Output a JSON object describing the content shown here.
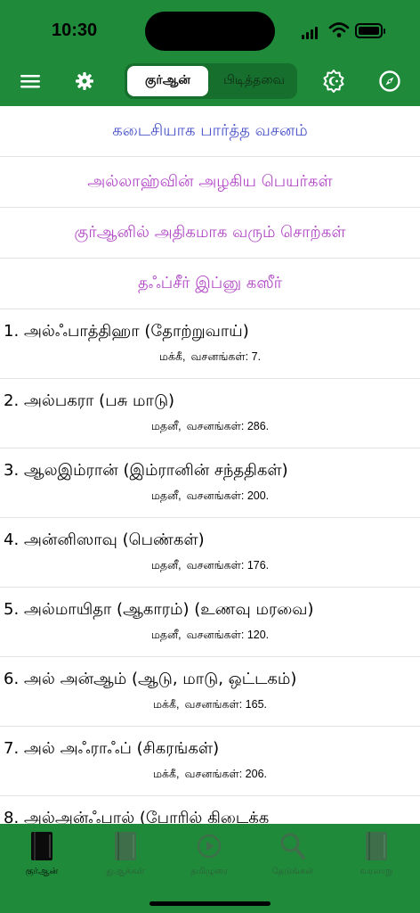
{
  "status": {
    "time": "10:30"
  },
  "nav": {
    "segments": [
      {
        "label": "குர்ஆன்",
        "active": true
      },
      {
        "label": "பிடித்தவை",
        "active": false
      }
    ],
    "icons": [
      "hamburger-menu-icon",
      "gear-icon",
      "crescent-star-icon",
      "compass-icon"
    ]
  },
  "menu": [
    {
      "label": "கடைசியாக பார்த்த வசனம்",
      "color": "#4a54c8"
    },
    {
      "label": "அல்லாஹ்வின் அழகிய பெயர்கள்",
      "color": "#b146c6"
    },
    {
      "label": "குர்ஆனில் அதிகமாக வரும் சொற்கள்",
      "color": "#b146c6"
    },
    {
      "label": "தஃப்சீர் இப்னு கஸீர்",
      "color": "#b146c6"
    }
  ],
  "chapters": [
    {
      "title": "1. அல்ஃபாத்திஹா (தோற்றுவாய்)",
      "place": "மக்கீ,",
      "verses": "வசனங்கள்: 7."
    },
    {
      "title": "2. அல்பகரா (பசு மாடு)",
      "place": "மதனீ,",
      "verses": "வசனங்கள்: 286."
    },
    {
      "title": "3. ஆலஇம்ரான் (இம்ரானின் சந்ததிகள்)",
      "place": "மதனீ,",
      "verses": "வசனங்கள்: 200."
    },
    {
      "title": "4. அன்னிஸாவு (பெண்கள்)",
      "place": "மதனீ,",
      "verses": "வசனங்கள்: 176."
    },
    {
      "title": "5. அல்மாயிதா (ஆகாரம்) (உணவு மரவை)",
      "place": "மதனீ,",
      "verses": "வசனங்கள்: 120."
    },
    {
      "title": "6. அல் அன்ஆம் (ஆடு, மாடு, ஒட்டகம்)",
      "place": "மக்கீ,",
      "verses": "வசனங்கள்: 165."
    },
    {
      "title": "7. அல் அஃராஃப் (சிகரங்கள்)",
      "place": "மக்கீ,",
      "verses": "வசனங்கள்: 206."
    },
    {
      "title": "8. அல்அன்ஃபால் (போரில் கிடைக்க",
      "place": "",
      "verses": ""
    }
  ],
  "tabs": [
    {
      "label": "குர்ஆன்",
      "icon": "book-icon",
      "active": true
    },
    {
      "label": "துஆக்கள்",
      "icon": "book-icon",
      "active": false
    },
    {
      "label": "தமிழுரை",
      "icon": "play-circle-icon",
      "active": false
    },
    {
      "label": "தேடுங்கள்",
      "icon": "search-icon",
      "active": false
    },
    {
      "label": "வரலாறு",
      "icon": "book-icon",
      "active": false
    }
  ],
  "colors": {
    "brand_green": "#1f8b3a",
    "link_blue": "#4a54c8",
    "link_violet": "#b146c6"
  }
}
